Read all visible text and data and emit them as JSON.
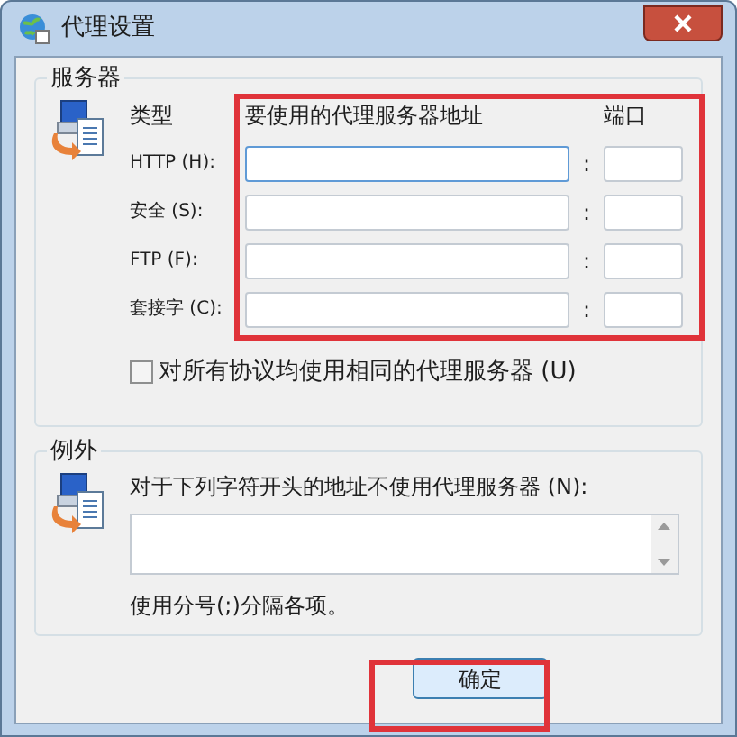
{
  "window": {
    "title": "代理设置"
  },
  "servers": {
    "title": "服务器",
    "type_header": "类型",
    "address_header": "要使用的代理服务器地址",
    "port_header": "端口",
    "rows": [
      {
        "label": "HTTP (H):",
        "separator": ":",
        "focused": true
      },
      {
        "label": "安全 (S):",
        "separator": ":",
        "focused": false
      },
      {
        "label": "FTP (F):",
        "separator": ":",
        "focused": false
      },
      {
        "label": "套接字 (C):",
        "separator": ":",
        "focused": false
      }
    ],
    "same_proxy": {
      "label": "对所有协议均使用相同的代理服务器 (U)",
      "checked": false
    }
  },
  "exceptions": {
    "title": "例外",
    "label": "对于下列字符开头的地址不使用代理服务器 (N):",
    "note": "使用分号(;)分隔各项。"
  },
  "buttons": [
    "确定"
  ]
}
